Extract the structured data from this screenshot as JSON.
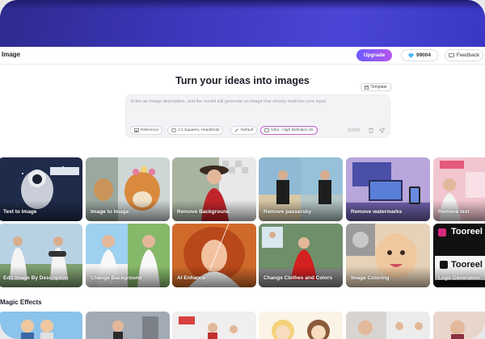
{
  "header": {
    "page_title": "Image",
    "upgrade_label": "Upgrade",
    "credits_value": "99004",
    "feedback_label": "Feedback"
  },
  "main": {
    "headline": "Turn your ideas into images",
    "template_label": "Template",
    "prompt_placeholder": "Enter an image description, and the model will generate an image that closely matches your input.",
    "chips": {
      "reference": "Reference",
      "ratio": "1:1 Squares, Headshots",
      "style": "Default",
      "quality": "Ultra - High Definition 2K"
    },
    "char_counter": "0/2000"
  },
  "tools": [
    {
      "label": "Text to Image"
    },
    {
      "label": "Image to Image"
    },
    {
      "label": "Remove Background"
    },
    {
      "label": "Remove passersby"
    },
    {
      "label": "Remove watermarks"
    },
    {
      "label": "Remove text"
    },
    {
      "label": "Edit Image By Description"
    },
    {
      "label": "Change Background"
    },
    {
      "label": "AI Enhance"
    },
    {
      "label": "Change Clothes and Colors"
    },
    {
      "label": "Image Coloring"
    },
    {
      "label": "Logo Generation"
    }
  ],
  "logo_text": "Tooreel",
  "magic": {
    "title": "Magic Effects"
  },
  "colors": {
    "hero": "#3b36b8",
    "upgrade_start": "#6a5cff",
    "upgrade_end": "#b455f0",
    "accent_chip": "#c85bd8"
  }
}
